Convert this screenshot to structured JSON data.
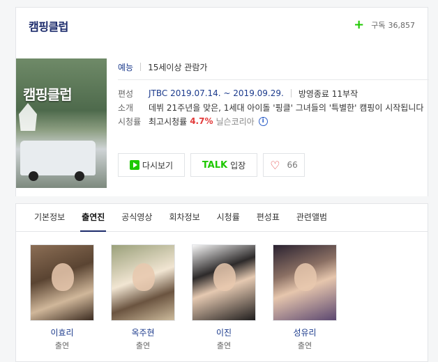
{
  "header": {
    "title": "캠핑클럽",
    "subscribe_label": "구독",
    "subscriber_count": "36,857"
  },
  "poster": {
    "title_text": "캠핑클럽"
  },
  "info": {
    "genre": "예능",
    "rating_class": "15세이상 관람가",
    "schedule_label": "편성",
    "schedule_value": "JTBC 2019.07.14. ~ 2019.09.29.",
    "status": "방영종료 11부작",
    "summary_label": "소개",
    "summary_value": "데뷔 21주년을 맞은, 1세대 아이돌 '핑클' 그녀들의 '특별한' 캠핑이 시작됩니다",
    "viewership_label": "시청률",
    "viewership_prefix": "최고시청률",
    "viewership_value": "4.7%",
    "viewership_source": "닐슨코리아"
  },
  "buttons": {
    "replay_label": "다시보기",
    "talk_badge": "TALK",
    "talk_label": "입장",
    "like_count": "66"
  },
  "tabs": [
    {
      "label": "기본정보"
    },
    {
      "label": "출연진"
    },
    {
      "label": "공식영상"
    },
    {
      "label": "회차정보"
    },
    {
      "label": "시청률"
    },
    {
      "label": "편성표"
    },
    {
      "label": "관련앨범"
    }
  ],
  "active_tab": "출연진",
  "cast": [
    {
      "name": "이효리",
      "role": "출연"
    },
    {
      "name": "옥주현",
      "role": "출연"
    },
    {
      "name": "이진",
      "role": "출연"
    },
    {
      "name": "성유리",
      "role": "출연"
    }
  ],
  "colors": {
    "accent_green": "#1ec800",
    "title_navy": "#1b2a6b",
    "rating_red": "#e23a3a"
  }
}
